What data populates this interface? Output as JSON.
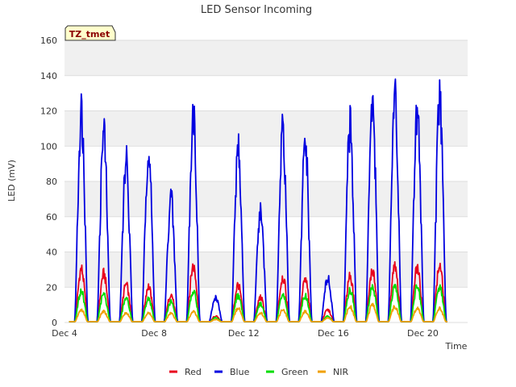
{
  "chart_data": {
    "type": "line",
    "title": "LED Sensor Incoming",
    "xlabel": "Time",
    "ylabel": "LED (mV)",
    "badge": "TZ_tmet",
    "ylim": [
      0,
      160
    ],
    "yticks": [
      0,
      20,
      40,
      60,
      80,
      100,
      120,
      140,
      160
    ],
    "xlim": [
      "Dec 4",
      "Dec 22"
    ],
    "xticks": [
      {
        "label": "Dec 4",
        "day": 4
      },
      {
        "label": "Dec 8",
        "day": 8
      },
      {
        "label": "Dec 12",
        "day": 12
      },
      {
        "label": "Dec 16",
        "day": 16
      },
      {
        "label": "Dec 20",
        "day": 20
      }
    ],
    "grid": true,
    "legend_position": "bottom",
    "day_start": 4,
    "day_end": 22,
    "series": [
      {
        "name": "Red",
        "color": "#e8001c",
        "peaks": [
          34,
          31,
          24,
          23,
          18,
          36,
          4,
          24,
          16,
          29,
          27,
          8,
          30,
          33,
          35,
          35,
          36
        ]
      },
      {
        "name": "Blue",
        "color": "#0000e0",
        "peaks": [
          134,
          121,
          103,
          110,
          79,
          134,
          16,
          110,
          72,
          120,
          114,
          28,
          124,
          141,
          142,
          137,
          140
        ]
      },
      {
        "name": "Green",
        "color": "#00dd00",
        "peaks": [
          20,
          18,
          15,
          15,
          13,
          20,
          3,
          17,
          12,
          18,
          17,
          4,
          21,
          23,
          23,
          23,
          23
        ]
      },
      {
        "name": "NIR",
        "color": "#f0a000",
        "peaks": [
          8,
          7,
          6,
          6,
          6,
          7,
          2,
          9,
          6,
          8,
          7,
          3,
          10,
          11,
          10,
          9,
          9
        ]
      }
    ],
    "day_centers": [
      4.75,
      5.75,
      6.75,
      7.75,
      8.75,
      9.75,
      10.75,
      11.75,
      12.75,
      13.75,
      14.75,
      15.75,
      16.75,
      17.75,
      18.75,
      19.75,
      20.75
    ]
  }
}
